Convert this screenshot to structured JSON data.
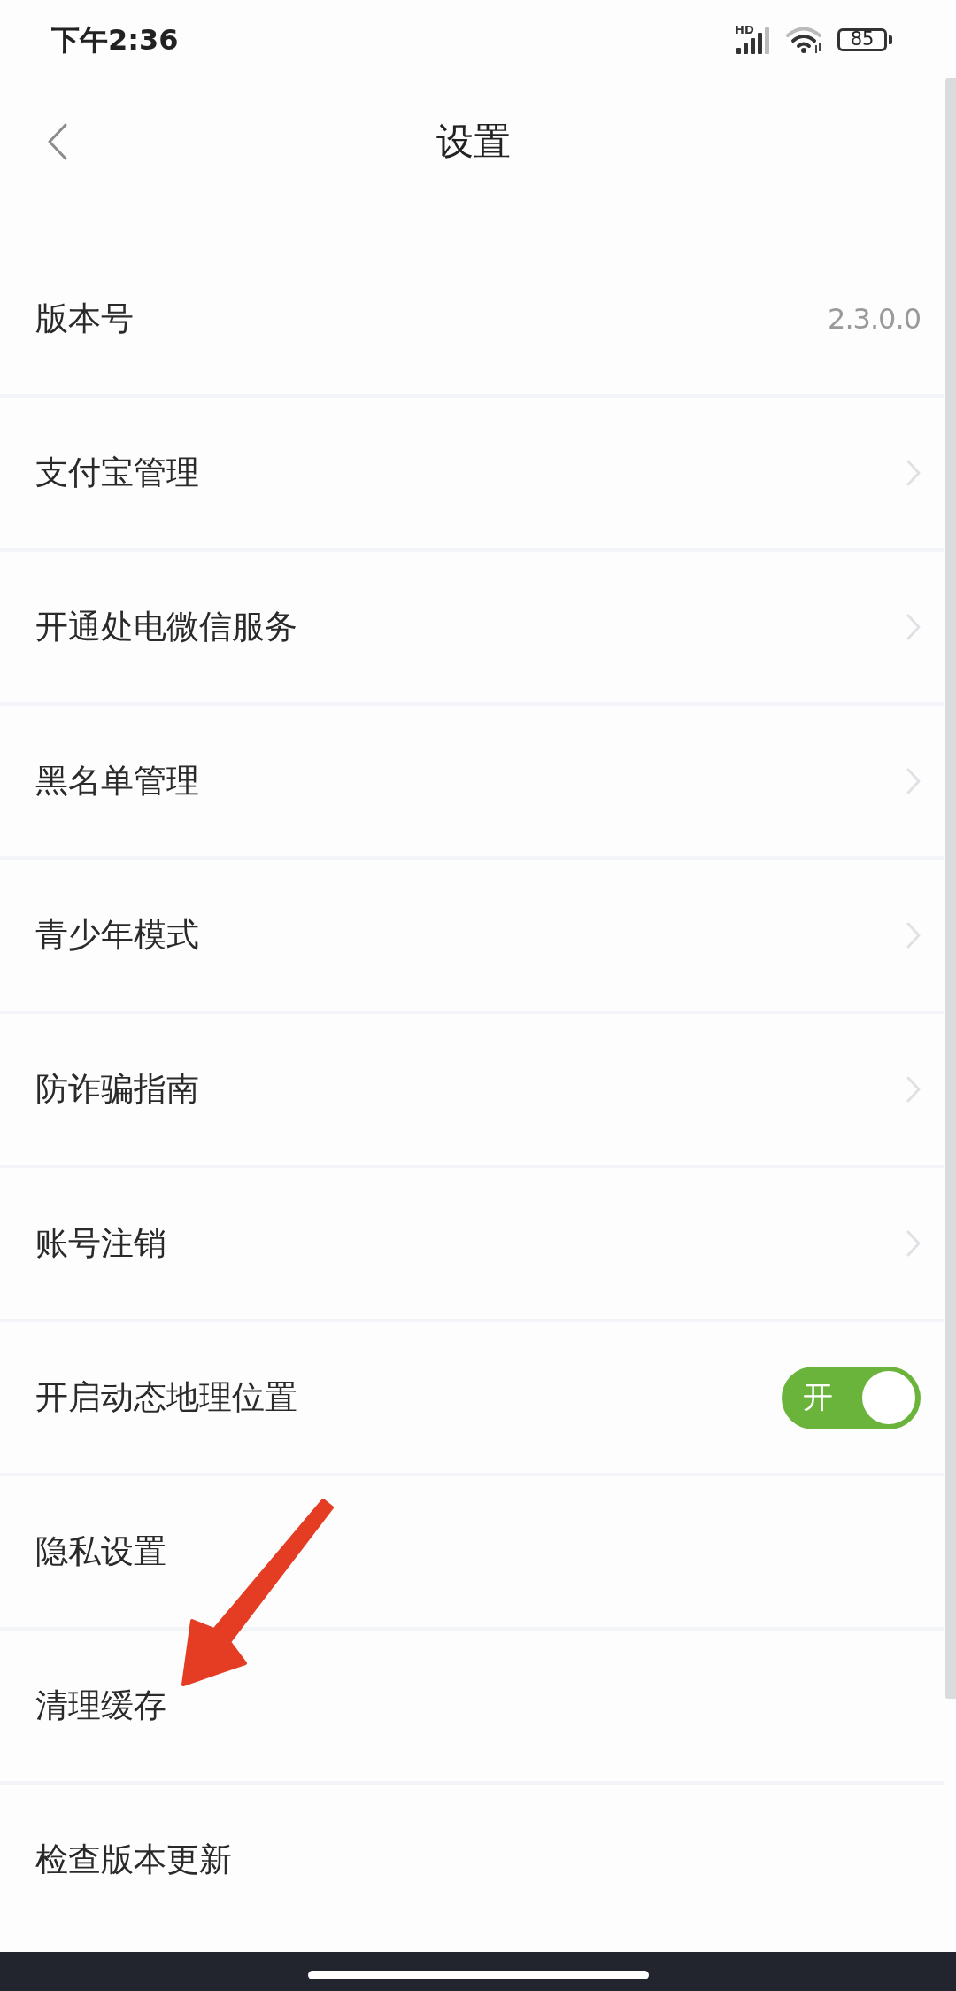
{
  "status_bar": {
    "time": "下午2:36",
    "network": "HD",
    "battery": "85"
  },
  "nav": {
    "title": "设置"
  },
  "settings": [
    {
      "kind": "value",
      "label": "版本号",
      "value": "2.3.0.0"
    },
    {
      "kind": "link",
      "label": "支付宝管理"
    },
    {
      "kind": "link",
      "label": "开通处电微信服务"
    },
    {
      "kind": "link",
      "label": "黑名单管理"
    },
    {
      "kind": "link",
      "label": "青少年模式"
    },
    {
      "kind": "link",
      "label": "防诈骗指南"
    },
    {
      "kind": "link",
      "label": "账号注销"
    },
    {
      "kind": "switch",
      "label": "开启动态地理位置",
      "on": true,
      "switch_text": "开"
    },
    {
      "kind": "plain",
      "label": "隐私设置"
    },
    {
      "kind": "plain",
      "label": "清理缓存"
    },
    {
      "kind": "plain",
      "label": "检查版本更新"
    }
  ],
  "annotation": {
    "kind": "arrow"
  }
}
